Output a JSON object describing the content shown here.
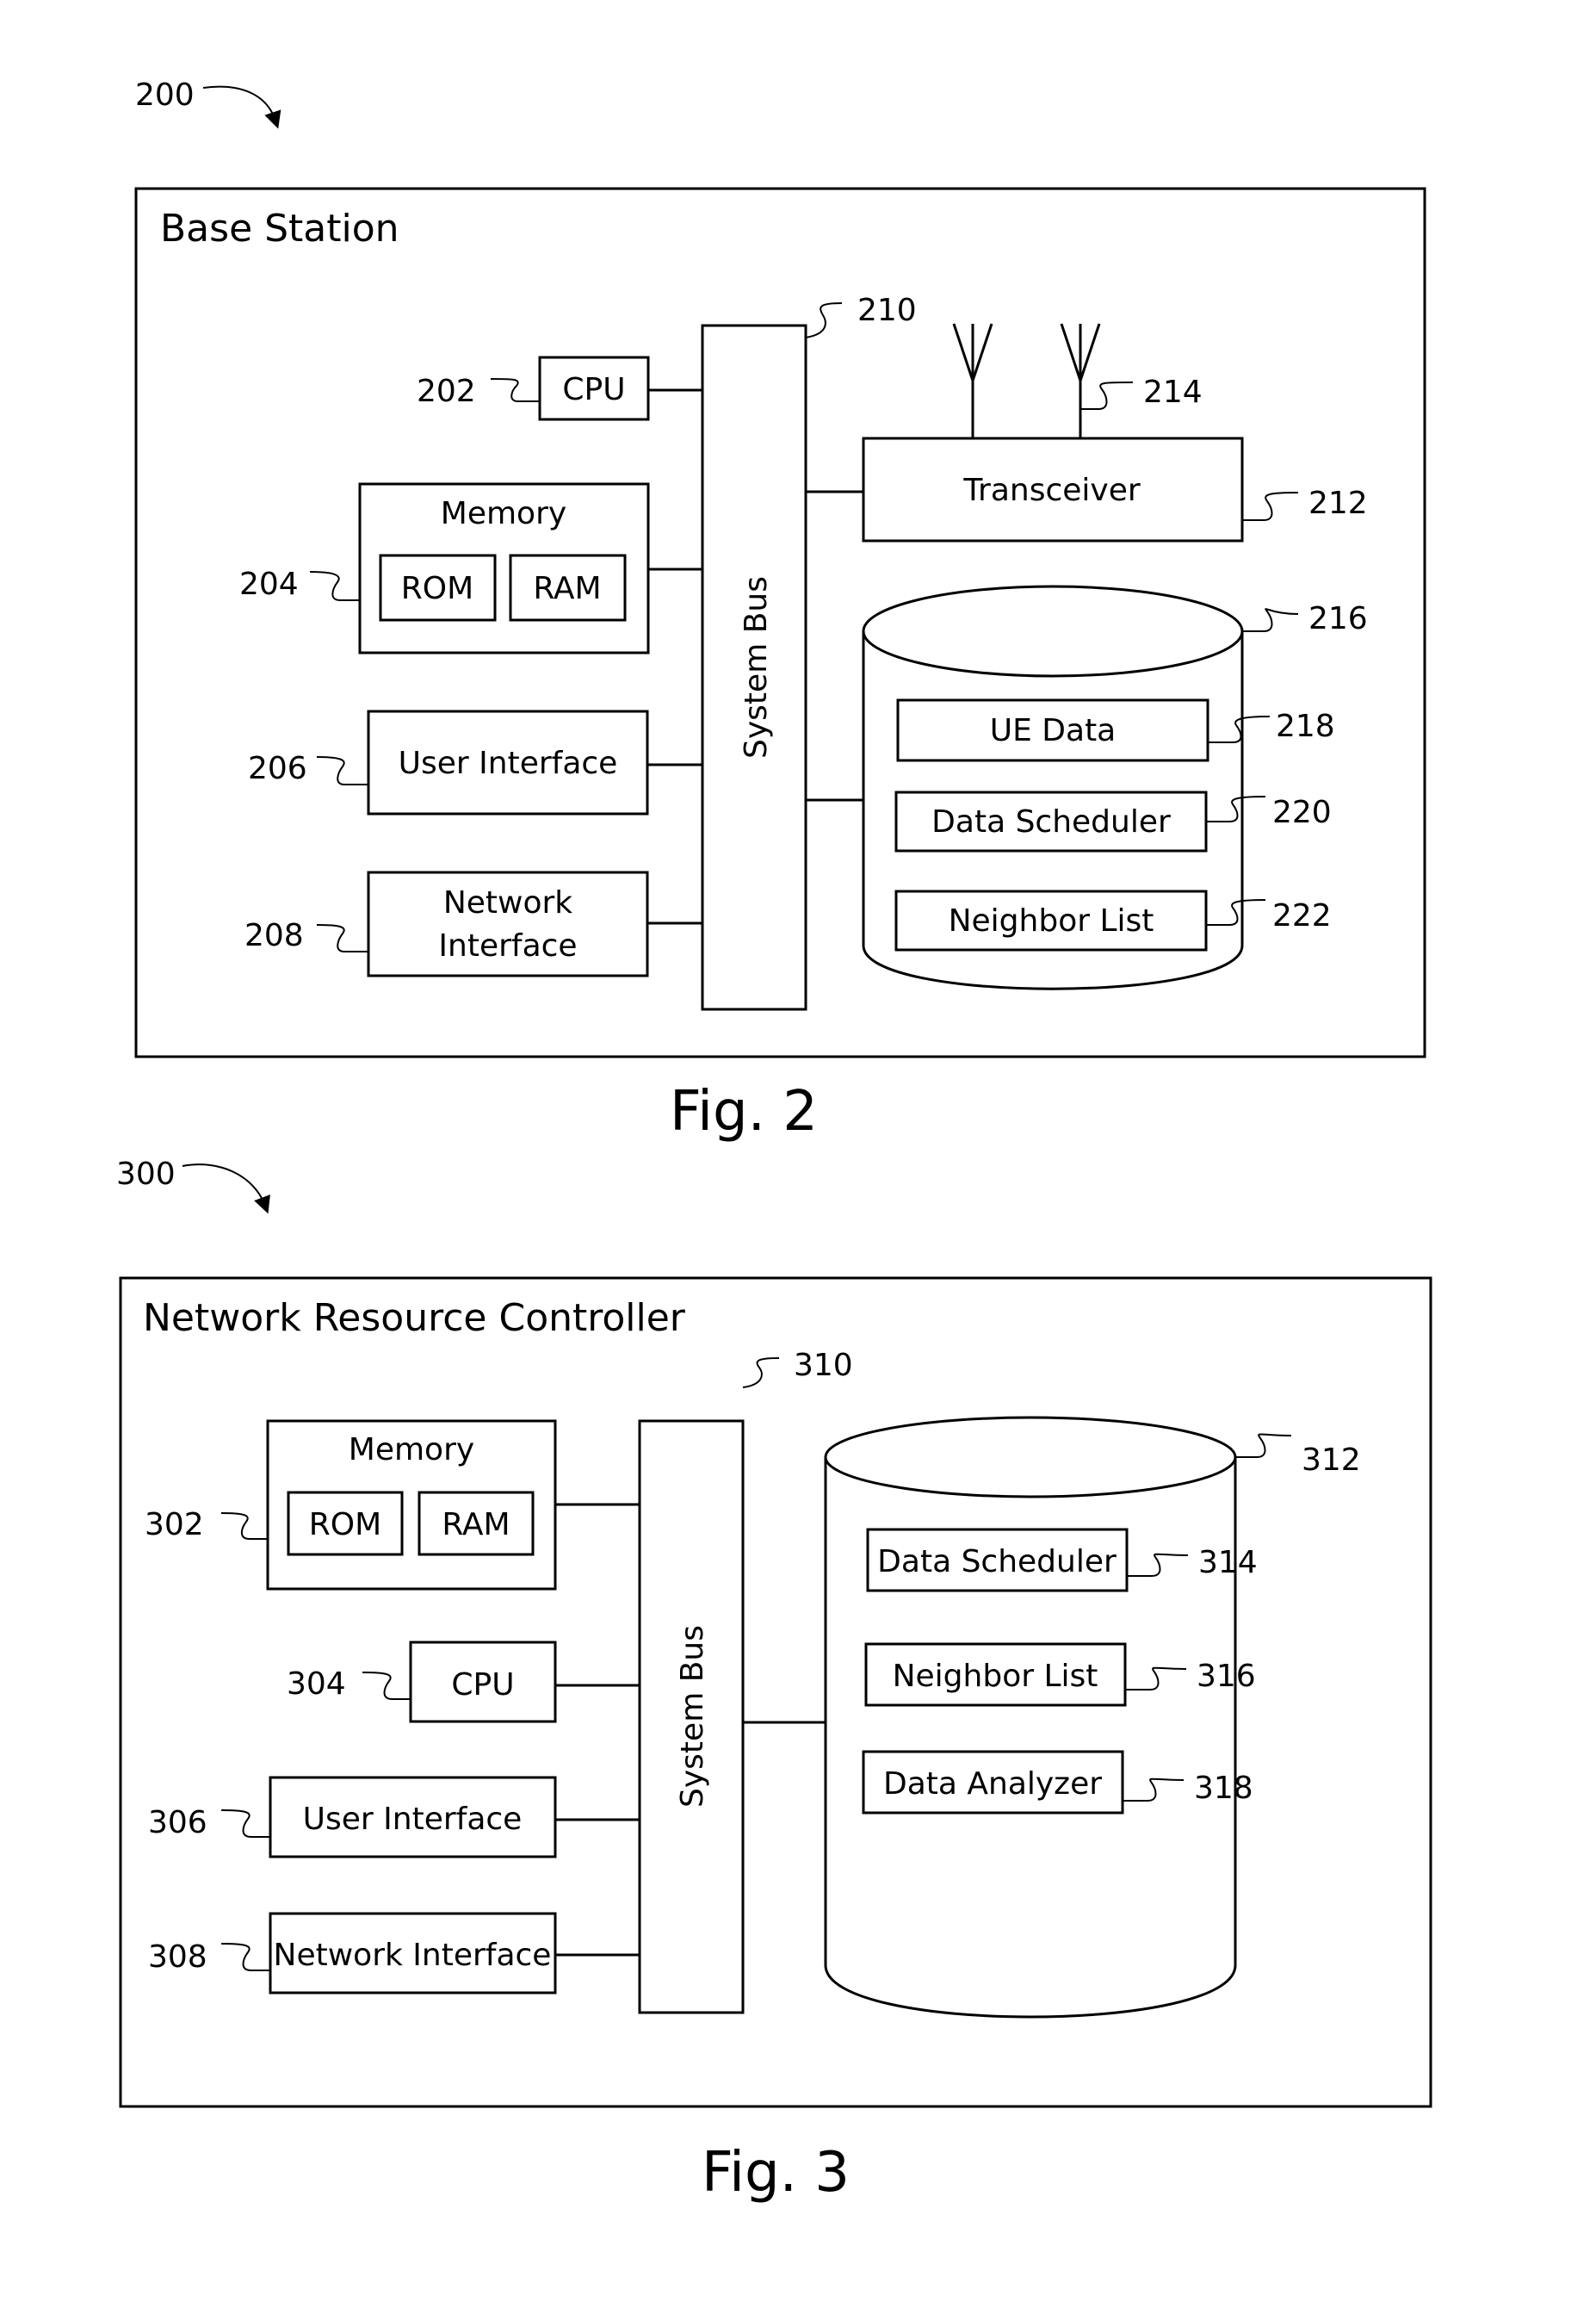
{
  "figures": [
    {
      "ref": "200",
      "title": "Base Station",
      "caption": "Fig. 2",
      "components": {
        "cpu": {
          "ref": "202",
          "label": "CPU"
        },
        "memory": {
          "ref": "204",
          "label": "Memory",
          "rom": "ROM",
          "ram": "RAM"
        },
        "user_interface": {
          "ref": "206",
          "label": "User Interface"
        },
        "network_interface": {
          "ref": "208",
          "label_line1": "Network",
          "label_line2": "Interface"
        },
        "system_bus": {
          "ref": "210",
          "label": "System Bus"
        },
        "transceiver": {
          "ref": "212",
          "label": "Transceiver"
        },
        "antenna": {
          "ref": "214"
        },
        "database": {
          "ref": "216",
          "items": [
            {
              "ref": "218",
              "label": "UE Data"
            },
            {
              "ref": "220",
              "label": "Data Scheduler"
            },
            {
              "ref": "222",
              "label": "Neighbor List"
            }
          ]
        }
      }
    },
    {
      "ref": "300",
      "title": "Network Resource Controller",
      "caption": "Fig. 3",
      "components": {
        "memory": {
          "ref": "302",
          "label": "Memory",
          "rom": "ROM",
          "ram": "RAM"
        },
        "cpu": {
          "ref": "304",
          "label": "CPU"
        },
        "user_interface": {
          "ref": "306",
          "label": "User Interface"
        },
        "network_interface": {
          "ref": "308",
          "label": "Network Interface"
        },
        "system_bus": {
          "ref": "310",
          "label": "System Bus"
        },
        "database": {
          "ref": "312",
          "items": [
            {
              "ref": "314",
              "label": "Data Scheduler"
            },
            {
              "ref": "316",
              "label": "Neighbor List"
            },
            {
              "ref": "318",
              "label": "Data Analyzer"
            }
          ]
        }
      }
    }
  ]
}
